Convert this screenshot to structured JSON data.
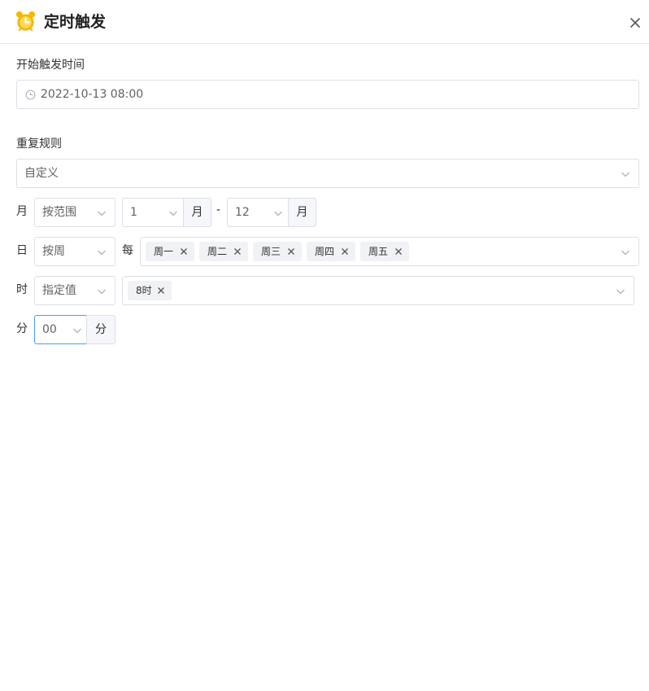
{
  "header": {
    "title": "定时触发",
    "logo_icon": "alarm-clock-icon",
    "close_icon": "close-icon"
  },
  "start_time": {
    "label": "开始触发时间",
    "value": "2022-10-13 08:00",
    "icon": "clock-icon"
  },
  "repeat": {
    "label": "重复规则",
    "value": "自定义"
  },
  "month_row": {
    "label": "月",
    "mode": "按范围",
    "from": "1",
    "from_unit": "月",
    "separator": "-",
    "to": "12",
    "to_unit": "月"
  },
  "day_row": {
    "label": "日",
    "mode": "按周",
    "each": "每",
    "tags": [
      "周一",
      "周二",
      "周三",
      "周四",
      "周五"
    ]
  },
  "hour_row": {
    "label": "时",
    "mode": "指定值",
    "tags": [
      "8时"
    ]
  },
  "minute_row": {
    "label": "分",
    "value": "00",
    "unit": "分"
  },
  "colors": {
    "accent": "#409eff",
    "logo": "#f5b800",
    "border": "#dcdfe6",
    "tag_bg": "#f0f2f5"
  }
}
